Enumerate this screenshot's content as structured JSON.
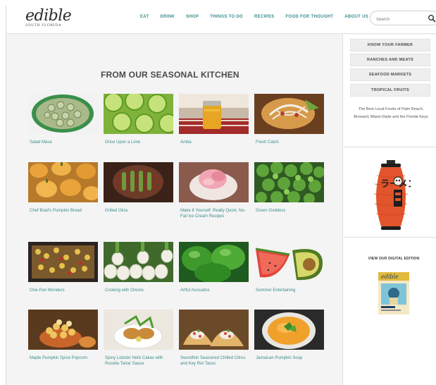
{
  "header": {
    "logo": {
      "main": "edible",
      "sub": "SOUTH FLORIDA"
    },
    "nav": [
      "EAT",
      "DRINK",
      "SHOP",
      "THINGS TO DO",
      "RECIPES",
      "FOOD FOR THOUGHT",
      "ABOUT US"
    ],
    "search": {
      "placeholder": "Search",
      "icon": "search-icon"
    }
  },
  "main": {
    "section_title": "FROM OUR SEASONAL KITCHEN",
    "recipes": [
      {
        "label": "Salad Masa",
        "image": "sliced-cucumbers-bowl"
      },
      {
        "label": "Once Upon a Lime",
        "image": "lime-slices"
      },
      {
        "label": "Amba",
        "image": "jar-of-sauce"
      },
      {
        "label": "Fresh Catch",
        "image": "fish-dish-with-onions"
      },
      {
        "label": "Chef Brad's Pumpkin Bread",
        "image": "pumpkins"
      },
      {
        "label": "Grilled Okra",
        "image": "grilled-okra-on-grill"
      },
      {
        "label": "Make It Yourself: Really Quick, No-Fail Ice Cream Recipes",
        "image": "pink-ice-cream"
      },
      {
        "label": "Green Goddess",
        "image": "green-herbs"
      },
      {
        "label": "One-Pan Wonders",
        "image": "sheet-pan-dish"
      },
      {
        "label": "Cooking with Onions",
        "image": "green-onions"
      },
      {
        "label": "Artful Avocados",
        "image": "green-peppers"
      },
      {
        "label": "Summer Entertaining",
        "image": "watermelon-and-avocado"
      },
      {
        "label": "Maple Pumpkin Spice Popcorn",
        "image": "popcorn"
      },
      {
        "label": "Spiny Lobster Herb Cakes with Rosella Tartar Sauce",
        "image": "lobster-cakes"
      },
      {
        "label": "Swordfish Seasoned Chilled Citrus and Key Rot Tacos",
        "image": "tacos"
      },
      {
        "label": "Jamaican Pumpkin Soup",
        "image": "pumpkin-soup"
      }
    ]
  },
  "sidebar": {
    "buttons": [
      "KNOW YOUR FARMER",
      "RANCHES AND MEATS",
      "SEAFOOD MARKETS",
      "TROPICAL FRUITS"
    ],
    "text": "The Best Local Foods of Palm Beach, Broward, Miami-Dade and the Florida Keys",
    "ad": {
      "glyphs": "ラーメン"
    },
    "digital_title": "VIEW OUR DIGITAL EDITION",
    "magazine": {
      "title": "edible"
    }
  },
  "colors": {
    "link": "#3b8c8c",
    "title": "#4a4a4a",
    "page_bg": "#f4f4f4"
  }
}
